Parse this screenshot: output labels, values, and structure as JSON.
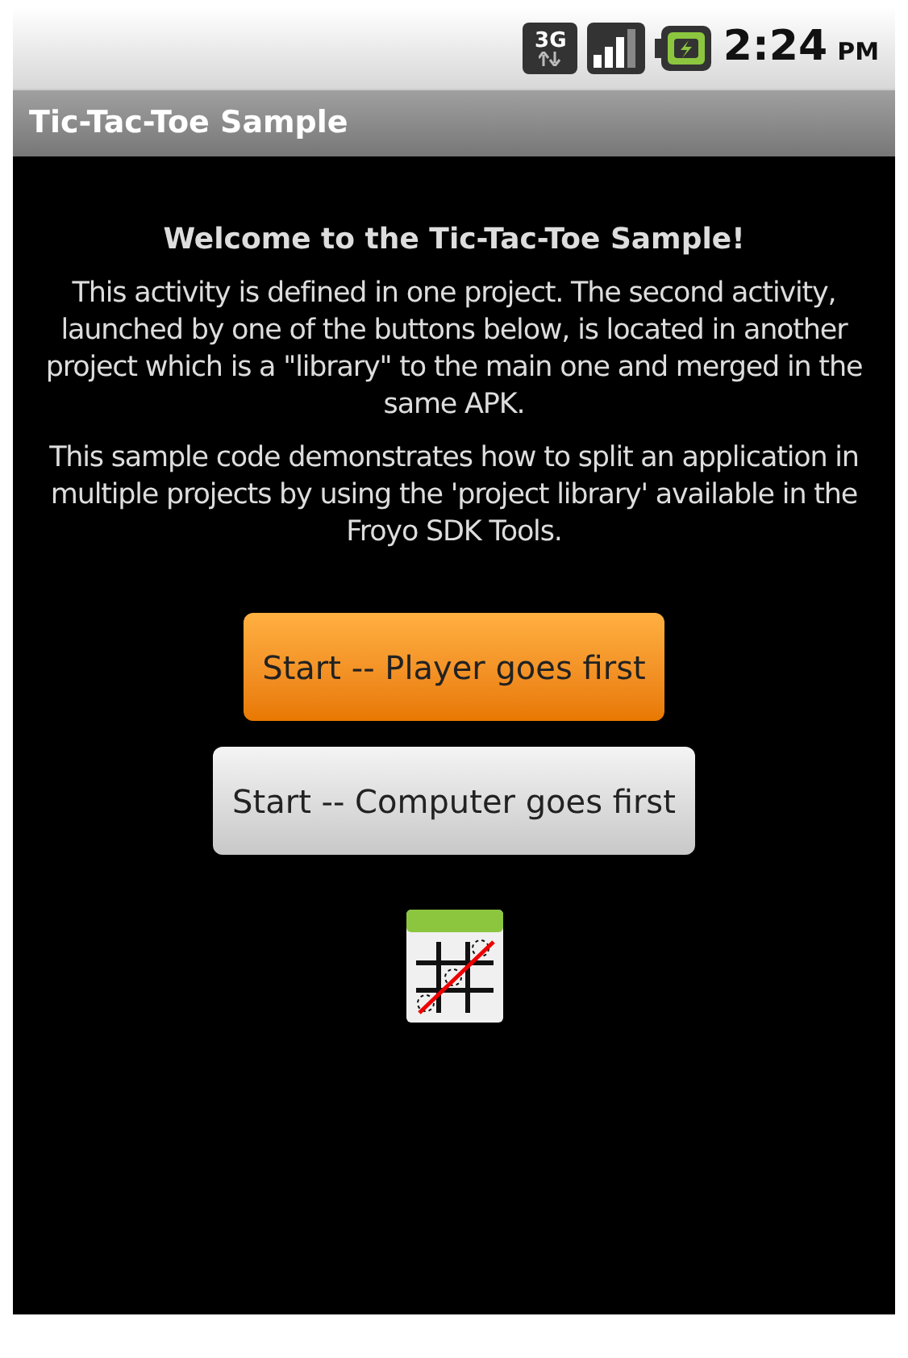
{
  "status_bar": {
    "network_type": "3G",
    "time": "2:24",
    "meridiem": "PM"
  },
  "title_bar": {
    "title": "Tic-Tac-Toe Sample"
  },
  "content": {
    "heading": "Welcome to the Tic-Tac-Toe Sample!",
    "paragraphs": [
      "This activity is defined in one project. The second activity, launched by one of the buttons below, is located in another project which is a \"library\" to the main one and merged in the same APK.",
      "This sample code demonstrates how to split an application in multiple projects by using the 'project library' available in the Froyo SDK Tools."
    ],
    "buttons": [
      {
        "label": "Start -- Player goes first",
        "selected": true
      },
      {
        "label": "Start -- Computer goes first",
        "selected": false
      }
    ]
  }
}
